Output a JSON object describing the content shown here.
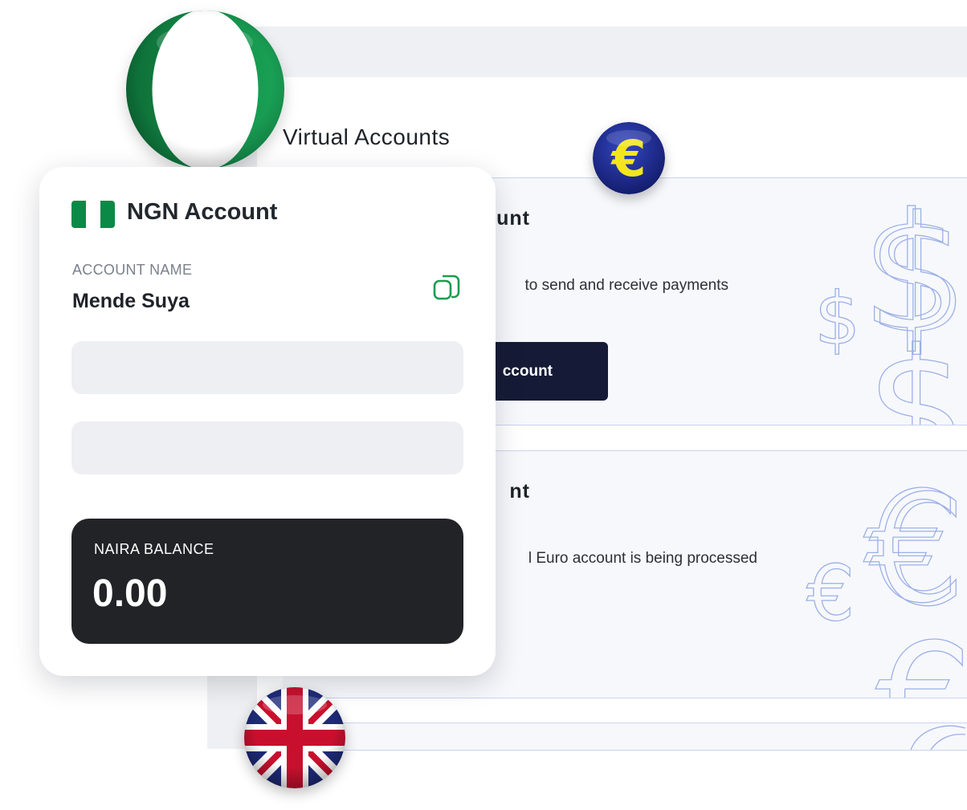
{
  "page": {
    "title": "Virtual Accounts"
  },
  "usd_card": {
    "title_fragment": "unt",
    "description_fragment": "to send and receive payments",
    "button_fragment": "ccount"
  },
  "eur_card": {
    "title_fragment": "nt",
    "description_fragment": "l Euro account is being processed"
  },
  "ngn_card": {
    "title": "NGN Account",
    "account_name_label": "ACCOUNT NAME",
    "account_name": "Mende Suya",
    "balance_label": "NAIRA BALANCE",
    "balance_value": "0.00"
  },
  "icons": [
    "nigeria-flag-icon",
    "euro-coin-icon",
    "uk-flag-icon",
    "copy-icon",
    "dollar-sign-icon",
    "euro-sign-icon"
  ],
  "colors": {
    "nigeria_green": "#0a8a46",
    "button_navy": "#151b36",
    "balance_dark": "#222326",
    "euro_blue": "#1c2a96",
    "euro_yellow": "#f3e61e",
    "copy_icon_green": "#1e9b4f"
  }
}
